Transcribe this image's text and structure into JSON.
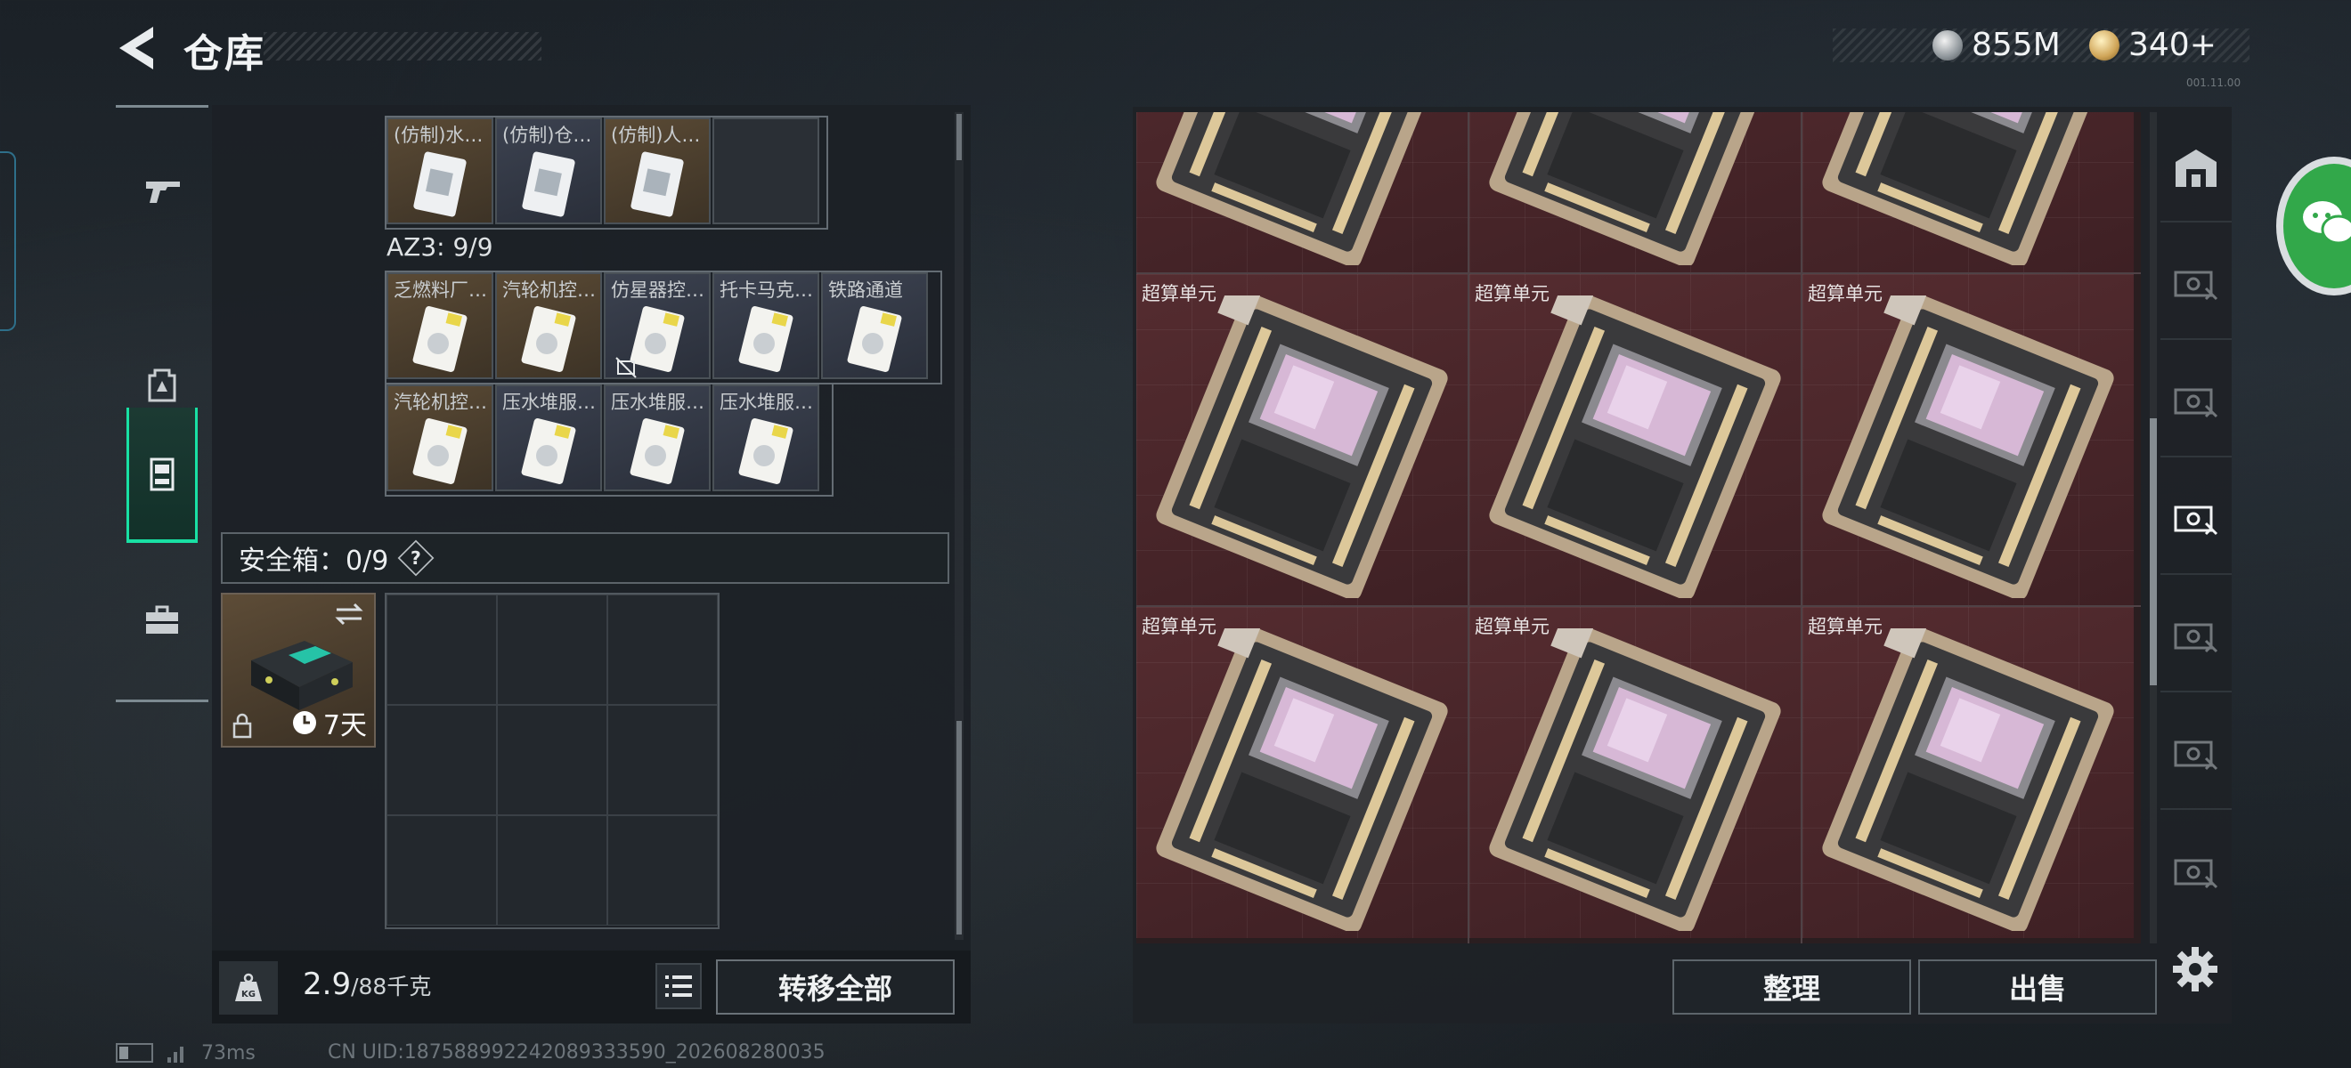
{
  "header": {
    "title": "仓库",
    "currency_a": "855M",
    "currency_b": "340+",
    "version": "001.11.00"
  },
  "nav": {
    "items": [
      {
        "icon": "pistol-icon"
      },
      {
        "icon": "backpack-icon"
      },
      {
        "icon": "container-icon",
        "active": true
      },
      {
        "icon": "toolbox-icon"
      }
    ]
  },
  "left_panel": {
    "top_row": [
      "(仿制)水…",
      "(仿制)仓…",
      "(仿制)人…"
    ],
    "az3_label": "AZ3: 9/9",
    "az3_row1": [
      "乏燃料厂…",
      "汽轮机控…",
      "仿星器控…",
      "托卡马克…",
      "铁路通道"
    ],
    "az3_row2": [
      "汽轮机控…",
      "压水堆服…",
      "压水堆服…",
      "压水堆服…"
    ],
    "safe_title": "安全箱：0/9",
    "help": "?",
    "safe_timer": "7天",
    "weight_current": "2.9",
    "weight_max": "/88千克",
    "transfer_all": "转移全部"
  },
  "stash": {
    "item_label": "超算单元",
    "tiles_visible_labels": 6,
    "sort_button": "整理",
    "sell_button": "出售",
    "tab_icons": [
      "storage-building-icon",
      "cash-register-icon",
      "cash-register-icon",
      "cash-register-icon",
      "cash-register-icon",
      "cash-register-icon",
      "cash-register-icon"
    ]
  },
  "status": {
    "ping": "73ms",
    "uid": "CN UID:187588992242089333590_202608280035"
  },
  "colors": {
    "accent_green": "#19e0a4",
    "stash_tile": "#552c30",
    "chat_green": "#32a84a"
  }
}
